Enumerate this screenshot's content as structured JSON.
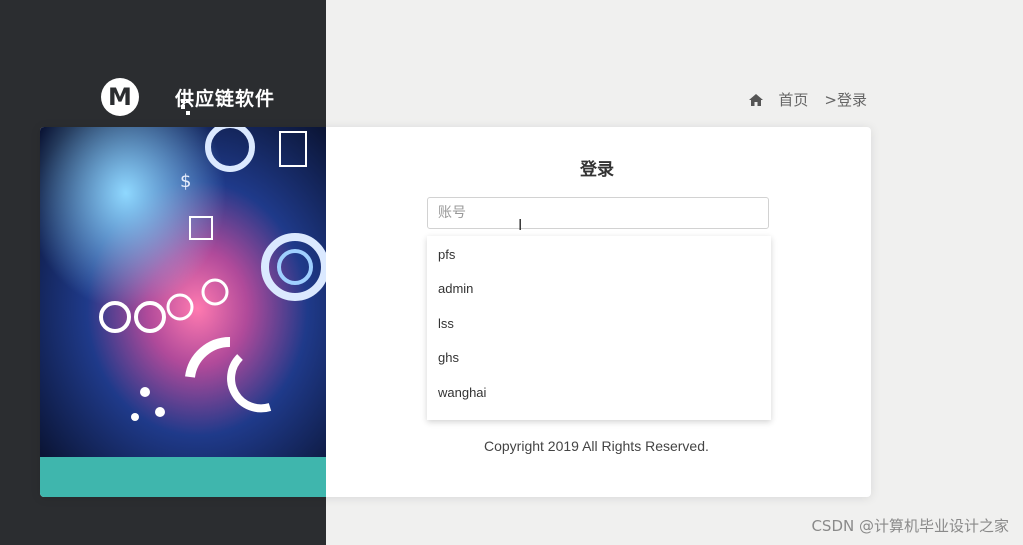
{
  "brand": {
    "name": "供应链软件",
    "mark_letter": "M"
  },
  "breadcrumb": {
    "home_icon": "home-icon",
    "home": "首页",
    "current": ">登录"
  },
  "login": {
    "title": "登录",
    "account_placeholder": "账号",
    "account_value": "",
    "suggestions": [
      "pfs",
      "admin",
      "lss",
      "ghs",
      "wanghai"
    ]
  },
  "footer": {
    "copyright": "Copyright 2019 All Rights Reserved."
  },
  "watermark": "CSDN @计算机毕业设计之家",
  "colors": {
    "sidebar": "#2b2d30",
    "accent_strip": "#3fb6ad",
    "background": "#f0f0ef"
  }
}
